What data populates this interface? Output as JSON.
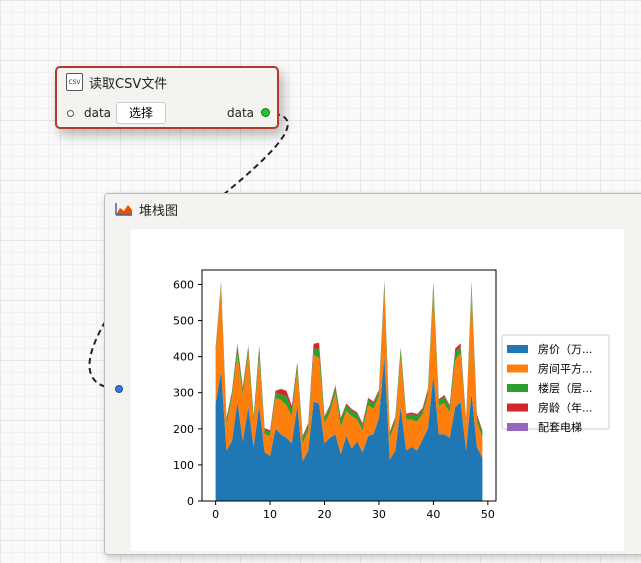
{
  "csv_node": {
    "title": "读取CSV文件",
    "icon": "csv-file-icon",
    "icon_text": "CSV",
    "input_label": "data",
    "output_label": "data",
    "select_label": "选择"
  },
  "chart_node": {
    "title": "堆栈图",
    "icon": "area-chart-icon"
  },
  "colors": {
    "node_border": "#b2392b",
    "series": [
      "#1f77b4",
      "#ff7f0e",
      "#2ca02c",
      "#d62728",
      "#9467bd"
    ]
  },
  "chart_data": {
    "type": "area",
    "stacked": true,
    "x": [
      0,
      1,
      2,
      3,
      4,
      5,
      6,
      7,
      8,
      9,
      10,
      11,
      12,
      13,
      14,
      15,
      16,
      17,
      18,
      19,
      20,
      21,
      22,
      23,
      24,
      25,
      26,
      27,
      28,
      29,
      30,
      31,
      32,
      33,
      34,
      35,
      36,
      37,
      38,
      39,
      40,
      41,
      42,
      43,
      44,
      45,
      46,
      47,
      48,
      49
    ],
    "xlim": [
      -2.5,
      51.5
    ],
    "ylim": [
      0,
      640
    ],
    "xticks": [
      0,
      10,
      20,
      30,
      40,
      50
    ],
    "yticks": [
      0,
      100,
      200,
      300,
      400,
      500,
      600
    ],
    "legend_position": "right",
    "grid": false,
    "series": [
      {
        "name": "房价（万...",
        "values": [
          270,
          360,
          140,
          165,
          275,
          165,
          260,
          150,
          265,
          135,
          125,
          200,
          185,
          175,
          160,
          265,
          110,
          140,
          275,
          270,
          160,
          175,
          185,
          130,
          180,
          145,
          165,
          135,
          180,
          185,
          230,
          400,
          115,
          140,
          260,
          140,
          150,
          140,
          170,
          200,
          350,
          185,
          185,
          175,
          260,
          275,
          140,
          300,
          150,
          120
        ]
      },
      {
        "name": "房间平方...",
        "values": [
          140,
          230,
          70,
          120,
          130,
          130,
          150,
          65,
          135,
          50,
          55,
          85,
          95,
          90,
          75,
          100,
          50,
          55,
          130,
          125,
          55,
          70,
          115,
          75,
          70,
          90,
          60,
          60,
          85,
          70,
          60,
          180,
          60,
          75,
          140,
          85,
          75,
          80,
          70,
          90,
          230,
          80,
          85,
          70,
          130,
          135,
          70,
          280,
          70,
          55
        ]
      },
      {
        "name": "楼层（层...",
        "values": [
          10,
          12,
          15,
          12,
          25,
          15,
          15,
          15,
          25,
          12,
          10,
          15,
          15,
          25,
          18,
          15,
          15,
          15,
          15,
          28,
          15,
          15,
          15,
          20,
          15,
          15,
          15,
          15,
          15,
          15,
          12,
          22,
          12,
          12,
          20,
          12,
          15,
          15,
          12,
          15,
          22,
          12,
          18,
          15,
          22,
          18,
          12,
          22,
          15,
          15
        ]
      },
      {
        "name": "房龄（年...",
        "values": [
          5,
          5,
          5,
          5,
          5,
          5,
          5,
          5,
          5,
          5,
          5,
          5,
          15,
          15,
          10,
          5,
          5,
          5,
          15,
          15,
          5,
          5,
          5,
          5,
          5,
          5,
          5,
          5,
          5,
          5,
          5,
          8,
          5,
          5,
          5,
          5,
          5,
          5,
          5,
          5,
          5,
          5,
          5,
          5,
          10,
          8,
          5,
          5,
          5,
          5
        ]
      },
      {
        "name": "配套电梯",
        "values": [
          1,
          1,
          0,
          1,
          1,
          1,
          1,
          0,
          1,
          0,
          1,
          1,
          1,
          1,
          1,
          1,
          0,
          0,
          1,
          1,
          0,
          1,
          1,
          1,
          0,
          0,
          1,
          0,
          1,
          1,
          1,
          1,
          0,
          1,
          1,
          0,
          1,
          1,
          0,
          1,
          1,
          0,
          1,
          1,
          1,
          1,
          0,
          1,
          1,
          1
        ]
      }
    ]
  }
}
